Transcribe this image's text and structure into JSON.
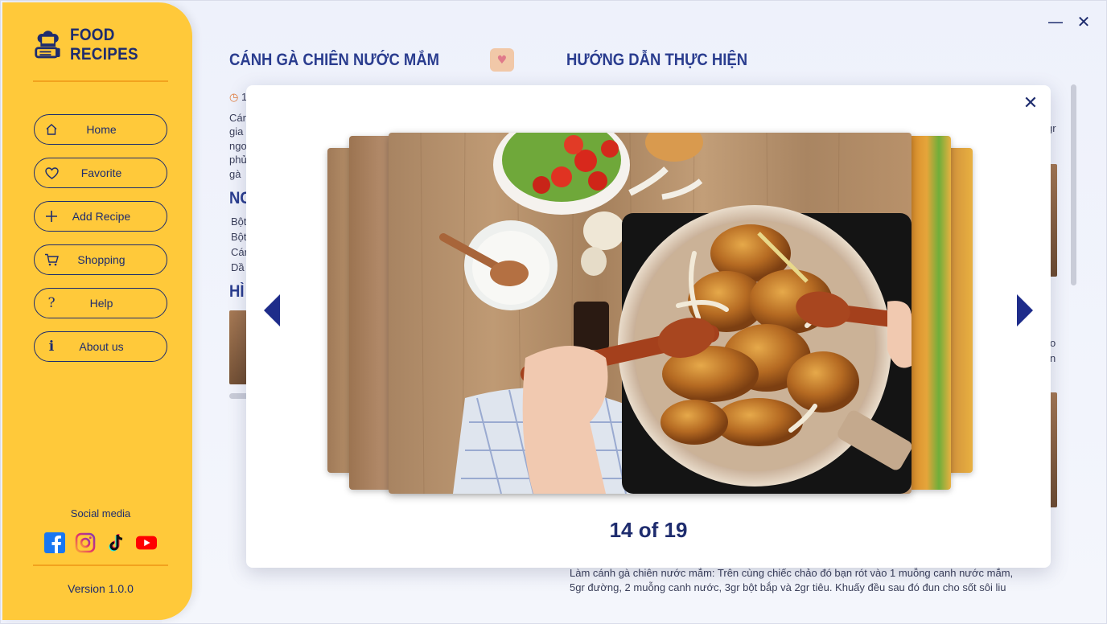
{
  "app": {
    "title": "FOOD RECIPES",
    "version": "Version 1.0.0",
    "colors": {
      "sidebar": "#ffc93a",
      "navy": "#1e2c6e",
      "accent_rule": "#f2a21e"
    }
  },
  "sidebar": {
    "items": [
      {
        "label": "Home",
        "icon": "home-icon"
      },
      {
        "label": "Favorite",
        "icon": "heart-icon"
      },
      {
        "label": "Add Recipe",
        "icon": "plus-icon"
      },
      {
        "label": "Shopping",
        "icon": "cart-icon"
      },
      {
        "label": "Help",
        "icon": "question-icon"
      },
      {
        "label": "About us",
        "icon": "info-icon"
      }
    ],
    "social_title": "Social media",
    "socials": [
      "facebook-icon",
      "instagram-icon",
      "tiktok-icon",
      "youtube-icon"
    ]
  },
  "window": {
    "minimize": "—",
    "close": "✕"
  },
  "recipe": {
    "title": "CÁNH GÀ CHIÊN NƯỚC MẮM",
    "instructions_title": "HƯỚNG DẪN THỰC HIỆN",
    "time_fragment": "1",
    "desc_fragments": [
      "Cán",
      "gia",
      "ngo",
      "phủ",
      "gà"
    ],
    "ingredients_fragment": "NG",
    "ingredient_fragments": [
      "Bột",
      "Bột",
      "Cán",
      "Dầ"
    ],
    "images_fragment": "HÌ",
    "right_fragments": [
      "gr",
      "o",
      "n"
    ],
    "step_line1": "Làm cánh gà chiên nước mắm: Trên cùng chiếc chảo đó bạn rót vào 1 muỗng canh nước mắm,",
    "step_line2": "5gr đường, 2 muỗng canh nước, 3gr bột bắp và 2gr tiêu. Khuấy đều sau đó đun cho sốt sôi liu"
  },
  "gallery": {
    "current": 14,
    "total": 19,
    "counter_text": "14 of 19",
    "close": "✕"
  }
}
